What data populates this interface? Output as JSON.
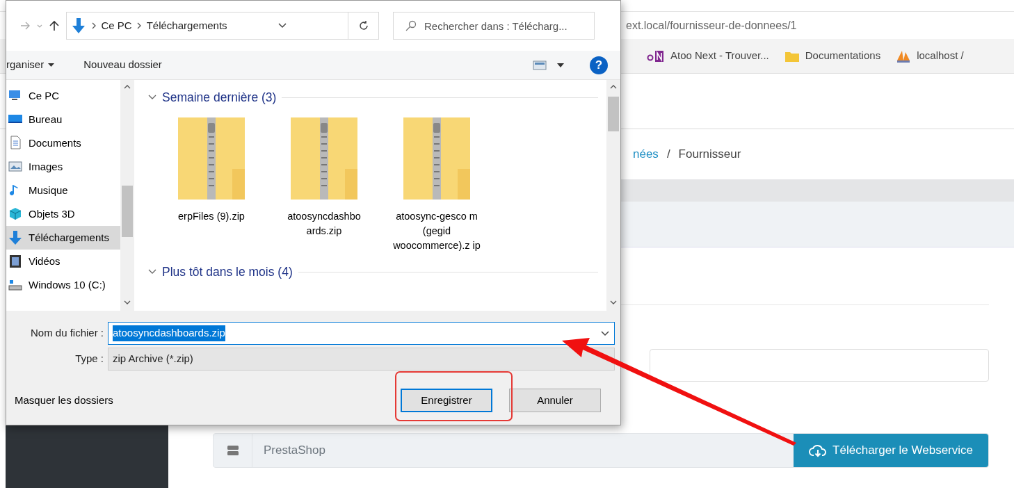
{
  "browser": {
    "address": "ext.local/fournisseur-de-donnees/1",
    "bookmarks": [
      {
        "kind": "onenote",
        "label": "Atoo Next - Trouver..."
      },
      {
        "kind": "folder",
        "label": "Documentations"
      },
      {
        "kind": "pma",
        "label": "localhost /"
      }
    ]
  },
  "breadcrumb": [
    {
      "label": "nées",
      "link": true
    },
    {
      "label": "Fournisseur",
      "link": false
    }
  ],
  "breadcrumb_separator": "/",
  "webservice": {
    "platform": "PrestaShop",
    "button": "Télécharger le Webservice"
  },
  "dialog": {
    "path": [
      "Ce PC",
      "Téléchargements"
    ],
    "search_placeholder": "Rechercher dans : Télécharg...",
    "toolbar": [
      "rganiser",
      "Nouveau dossier"
    ],
    "help": "?",
    "nav": [
      {
        "kind": "pc",
        "label": "Ce PC",
        "selected": false
      },
      {
        "kind": "desktop",
        "label": "Bureau",
        "selected": false
      },
      {
        "kind": "documents",
        "label": "Documents",
        "selected": false
      },
      {
        "kind": "images",
        "label": "Images",
        "selected": false
      },
      {
        "kind": "music",
        "label": "Musique",
        "selected": false
      },
      {
        "kind": "objects3d",
        "label": "Objets 3D",
        "selected": false
      },
      {
        "kind": "download",
        "label": "Téléchargements",
        "selected": true
      },
      {
        "kind": "video",
        "label": "Vidéos",
        "selected": false
      },
      {
        "kind": "drive",
        "label": "Windows 10 (C:)",
        "selected": false
      }
    ],
    "groups": [
      {
        "title": "Semaine dernière (3)",
        "expanded": true,
        "files": [
          "erpFiles (9).zip",
          "atoosyncdashbo ards.zip",
          "atoosync-gesco m (gegid woocommerce).z ip"
        ]
      },
      {
        "title": "Plus tôt dans le mois (4)",
        "expanded": true
      }
    ],
    "filename_label": "Nom du fichier :",
    "filename": "atoosyncdashboards.zip",
    "type_label": "Type :",
    "type": "zip Archive (*.zip)",
    "hide_folders": "Masquer les dossiers",
    "buttons": [
      {
        "label": "Enregistrer",
        "default": true
      },
      {
        "label": "Annuler",
        "default": false
      }
    ]
  }
}
